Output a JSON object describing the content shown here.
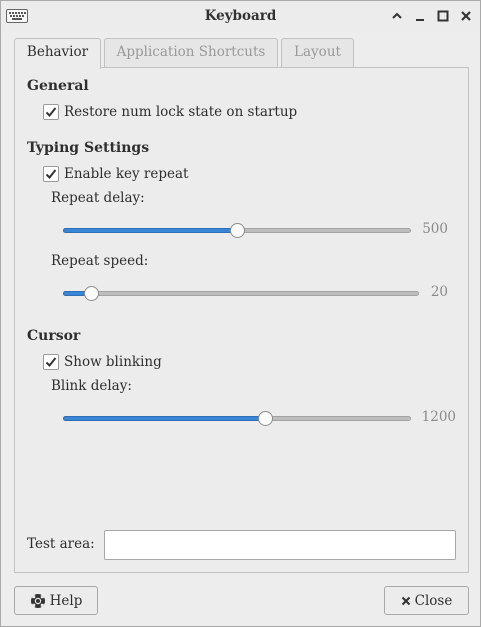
{
  "window": {
    "title": "Keyboard",
    "controls": [
      "minimize-up-icon",
      "minimize-icon",
      "maximize-icon",
      "close-icon"
    ]
  },
  "tabs": [
    {
      "label": "Behavior",
      "active": true
    },
    {
      "label": "Application Shortcuts",
      "active": false
    },
    {
      "label": "Layout",
      "active": false
    }
  ],
  "general": {
    "title": "General",
    "restore_numlock": {
      "label": "Restore num lock state on startup",
      "checked": true
    }
  },
  "typing": {
    "title": "Typing Settings",
    "enable_repeat": {
      "label": "Enable key repeat",
      "checked": true
    },
    "repeat_delay": {
      "label": "Repeat delay:",
      "value": "500",
      "fraction": 0.5
    },
    "repeat_speed": {
      "label": "Repeat speed:",
      "value": "20",
      "fraction": 0.08
    }
  },
  "cursor": {
    "title": "Cursor",
    "show_blinking": {
      "label": "Show blinking",
      "checked": true
    },
    "blink_delay": {
      "label": "Blink delay:",
      "value": "1200",
      "fraction": 0.58
    }
  },
  "test_area": {
    "label": "Test area:",
    "value": ""
  },
  "buttons": {
    "help": "Help",
    "close": "Close"
  },
  "colors": {
    "accent": "#3a86d6",
    "background": "#ededed"
  }
}
